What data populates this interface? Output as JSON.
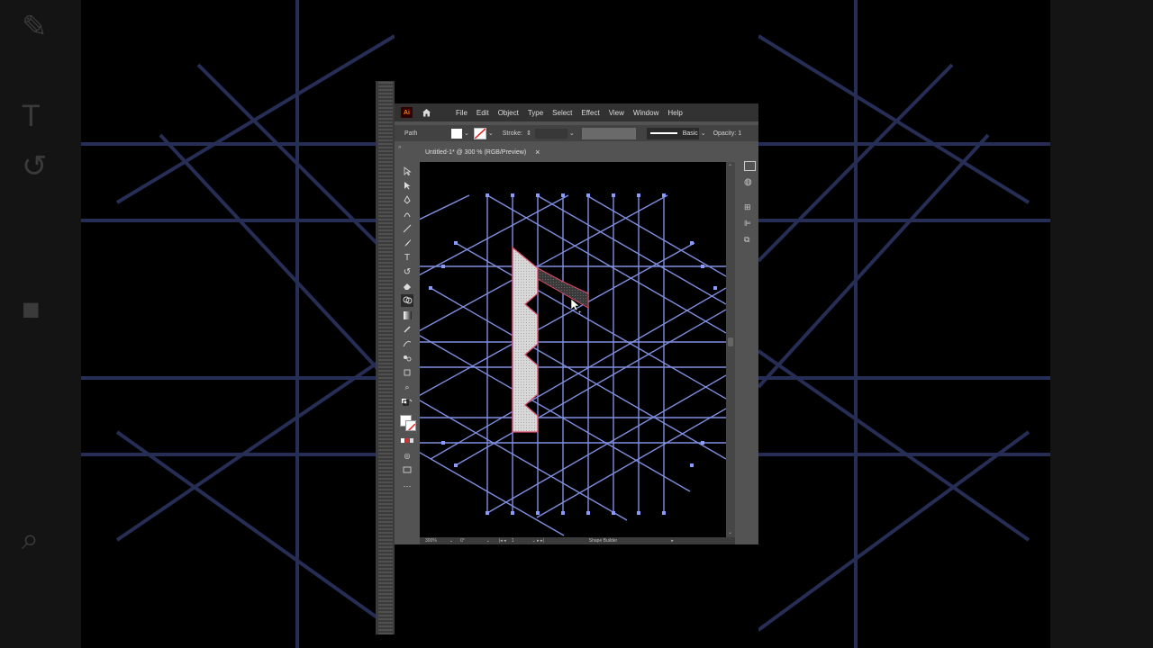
{
  "menubar": {
    "logo": "Ai",
    "items": [
      "File",
      "Edit",
      "Object",
      "Type",
      "Select",
      "Effect",
      "View",
      "Window",
      "Help"
    ]
  },
  "controlbar": {
    "selection_label": "Path",
    "stroke_label": "Stroke:",
    "brush_label": "Basic",
    "opacity_label": "Opacity:",
    "opacity_value": "1"
  },
  "document_tab": {
    "title": "Untitled-1* @ 300 % (RGB/Preview)",
    "close": "×"
  },
  "statusbar": {
    "zoom": "300%",
    "rotation": "0°",
    "artboard": "1",
    "tool_name": "Shape Builder"
  },
  "colors": {
    "app_bg": "#535353",
    "menubar_bg": "#323232",
    "guide_lines": "#7f8fe0",
    "selection": "#e04a6a",
    "canvas_bg": "#000000"
  },
  "tools": [
    "selection-tool",
    "direct-selection-tool",
    "pen-tool",
    "curvature-tool",
    "line-tool",
    "paintbrush-tool",
    "type-tool",
    "rotate-tool",
    "eraser-tool",
    "shape-builder-tool",
    "gradient-tool",
    "eyedropper-tool",
    "blend-tool",
    "symbol-sprayer-tool",
    "artboard-tool",
    "zoom-tool"
  ]
}
